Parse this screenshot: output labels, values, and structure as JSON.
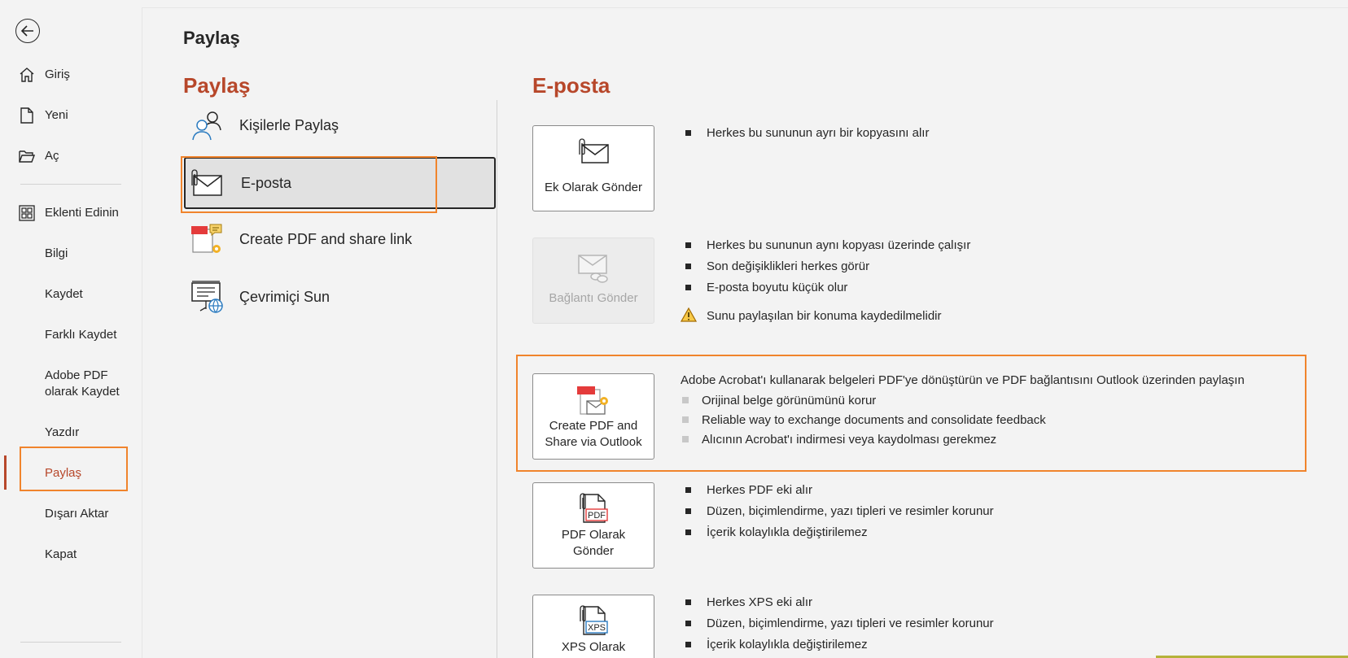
{
  "nav": {
    "back_label": "Geri",
    "items": [
      {
        "label": "Giriş",
        "icon": "home-icon"
      },
      {
        "label": "Yeni",
        "icon": "new-document-icon"
      },
      {
        "label": "Aç",
        "icon": "open-folder-icon"
      },
      {
        "label": "Eklenti Edinin",
        "icon": "add-ins-icon"
      },
      {
        "label": "Bilgi"
      },
      {
        "label": "Kaydet"
      },
      {
        "label": "Farklı Kaydet"
      },
      {
        "label": "Adobe PDF olarak Kaydet",
        "line1": "Adobe PDF",
        "line2": "olarak Kaydet"
      },
      {
        "label": "Yazdır"
      },
      {
        "label": "Paylaş",
        "active": true
      },
      {
        "label": "Dışarı Aktar"
      },
      {
        "label": "Kapat"
      }
    ]
  },
  "page": {
    "title": "Paylaş",
    "share_heading": "Paylaş",
    "email_heading": "E-posta"
  },
  "share_options": [
    {
      "label": "Kişilerle Paylaş",
      "icon": "people-icon"
    },
    {
      "label": "E-posta",
      "icon": "email-attachment-icon",
      "selected": true
    },
    {
      "label": "Create PDF and share link",
      "icon": "create-pdf-icon"
    },
    {
      "label": "Çevrimiçi Sun",
      "icon": "present-online-icon"
    }
  ],
  "email_actions": [
    {
      "label": "Ek Olarak Gönder",
      "icon": "attachment-envelope-icon",
      "bullets": [
        "Herkes bu sununun ayrı bir kopyasını alır"
      ]
    },
    {
      "label": "Bağlantı Gönder",
      "icon": "link-envelope-icon",
      "disabled": true,
      "bullets": [
        "Herkes bu sununun aynı kopyası üzerinde çalışır",
        "Son değişiklikleri herkes görür",
        "E-posta boyutu küçük olur"
      ],
      "warning": "Sunu paylaşılan bir konuma kaydedilmelidir"
    },
    {
      "label_line1": "Create PDF and",
      "label_line2": "Share via Outlook",
      "icon": "acrobat-share-icon",
      "description": "Adobe Acrobat'ı kullanarak belgeleri PDF'ye dönüştürün ve PDF bağlantısını Outlook üzerinden paylaşın",
      "bullets": [
        "Orijinal belge görünümünü korur",
        "Reliable way to exchange documents and consolidate feedback",
        "Alıcının Acrobat'ı indirmesi veya kaydolması gerekmez"
      ]
    },
    {
      "label_line1": "PDF Olarak",
      "label_line2": "Gönder",
      "icon": "pdf-attachment-icon",
      "icon_text": "PDF",
      "bullets": [
        "Herkes PDF eki alır",
        "Düzen, biçimlendirme, yazı tipleri ve resimler korunur",
        "İçerik kolaylıkla değiştirilemez"
      ]
    },
    {
      "label_line1": "XPS Olarak",
      "icon": "xps-attachment-icon",
      "icon_text": "XPS",
      "bullets": [
        "Herkes XPS eki alır",
        "Düzen, biçimlendirme, yazı tipleri ve resimler korunur",
        "İçerik kolaylıkla değiştirilemez"
      ]
    }
  ],
  "colors": {
    "accent": "#b7472a",
    "highlight": "#f0842c",
    "background": "#f3f3f3"
  }
}
